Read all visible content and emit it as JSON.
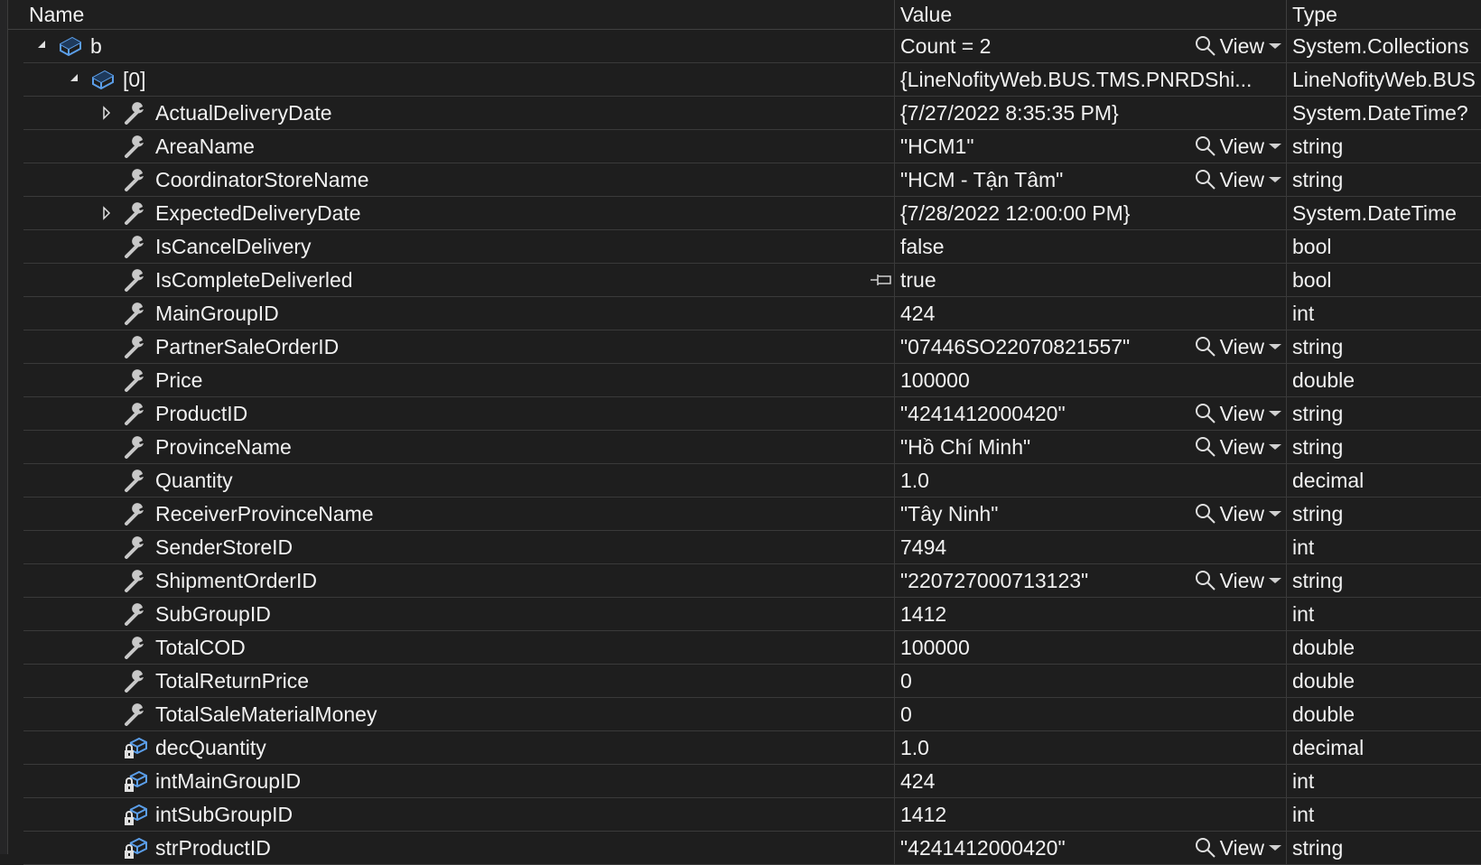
{
  "columns": {
    "name": "Name",
    "value": "Value",
    "type": "Type"
  },
  "view_label": "View",
  "rows": [
    {
      "name": "b",
      "value": "Count = 2",
      "type": "System.Collections",
      "level": 0,
      "expander": "expanded",
      "icon": "object-icon",
      "view": true
    },
    {
      "name": "[0]",
      "value": "{LineNofityWeb.BUS.TMS.PNRDShi...",
      "type": "LineNofityWeb.BUS",
      "level": 1,
      "expander": "expanded",
      "icon": "object-icon",
      "view": false
    },
    {
      "name": "ActualDeliveryDate",
      "value": "{7/27/2022 8:35:35 PM}",
      "type": "System.DateTime?",
      "level": 2,
      "expander": "collapsed",
      "icon": "property-icon",
      "view": false
    },
    {
      "name": "AreaName",
      "value": "\"HCM1\"",
      "type": "string",
      "level": 2,
      "expander": "none",
      "icon": "property-icon",
      "view": true
    },
    {
      "name": "CoordinatorStoreName",
      "value": "\"HCM - Tận Tâm\"",
      "type": "string",
      "level": 2,
      "expander": "none",
      "icon": "property-icon",
      "view": true
    },
    {
      "name": "ExpectedDeliveryDate",
      "value": "{7/28/2022 12:00:00 PM}",
      "type": "System.DateTime",
      "level": 2,
      "expander": "collapsed",
      "icon": "property-icon",
      "view": false
    },
    {
      "name": "IsCancelDelivery",
      "value": "false",
      "type": "bool",
      "level": 2,
      "expander": "none",
      "icon": "property-icon",
      "view": false
    },
    {
      "name": "IsCompleteDeliverled",
      "value": "true",
      "type": "bool",
      "level": 2,
      "expander": "none",
      "icon": "property-icon",
      "view": false,
      "pin": true
    },
    {
      "name": "MainGroupID",
      "value": "424",
      "type": "int",
      "level": 2,
      "expander": "none",
      "icon": "property-icon",
      "view": false
    },
    {
      "name": "PartnerSaleOrderID",
      "value": "\"07446SO22070821557\"",
      "type": "string",
      "level": 2,
      "expander": "none",
      "icon": "property-icon",
      "view": true
    },
    {
      "name": "Price",
      "value": "100000",
      "type": "double",
      "level": 2,
      "expander": "none",
      "icon": "property-icon",
      "view": false
    },
    {
      "name": "ProductID",
      "value": "\"4241412000420\"",
      "type": "string",
      "level": 2,
      "expander": "none",
      "icon": "property-icon",
      "view": true
    },
    {
      "name": "ProvinceName",
      "value": "\"Hồ Chí Minh\"",
      "type": "string",
      "level": 2,
      "expander": "none",
      "icon": "property-icon",
      "view": true
    },
    {
      "name": "Quantity",
      "value": "1.0",
      "type": "decimal",
      "level": 2,
      "expander": "none",
      "icon": "property-icon",
      "view": false
    },
    {
      "name": "ReceiverProvinceName",
      "value": "\"Tây Ninh\"",
      "type": "string",
      "level": 2,
      "expander": "none",
      "icon": "property-icon",
      "view": true
    },
    {
      "name": "SenderStoreID",
      "value": "7494",
      "type": "int",
      "level": 2,
      "expander": "none",
      "icon": "property-icon",
      "view": false
    },
    {
      "name": "ShipmentOrderID",
      "value": "\"220727000713123\"",
      "type": "string",
      "level": 2,
      "expander": "none",
      "icon": "property-icon",
      "view": true
    },
    {
      "name": "SubGroupID",
      "value": "1412",
      "type": "int",
      "level": 2,
      "expander": "none",
      "icon": "property-icon",
      "view": false
    },
    {
      "name": "TotalCOD",
      "value": "100000",
      "type": "double",
      "level": 2,
      "expander": "none",
      "icon": "property-icon",
      "view": false
    },
    {
      "name": "TotalReturnPrice",
      "value": "0",
      "type": "double",
      "level": 2,
      "expander": "none",
      "icon": "property-icon",
      "view": false
    },
    {
      "name": "TotalSaleMaterialMoney",
      "value": "0",
      "type": "double",
      "level": 2,
      "expander": "none",
      "icon": "property-icon",
      "view": false
    },
    {
      "name": "decQuantity",
      "value": "1.0",
      "type": "decimal",
      "level": 2,
      "expander": "none",
      "icon": "private-field-icon",
      "view": false
    },
    {
      "name": "intMainGroupID",
      "value": "424",
      "type": "int",
      "level": 2,
      "expander": "none",
      "icon": "private-field-icon",
      "view": false
    },
    {
      "name": "intSubGroupID",
      "value": "1412",
      "type": "int",
      "level": 2,
      "expander": "none",
      "icon": "private-field-icon",
      "view": false
    },
    {
      "name": "strProductID",
      "value": "\"4241412000420\"",
      "type": "string",
      "level": 2,
      "expander": "none",
      "icon": "private-field-icon",
      "view": true
    }
  ]
}
